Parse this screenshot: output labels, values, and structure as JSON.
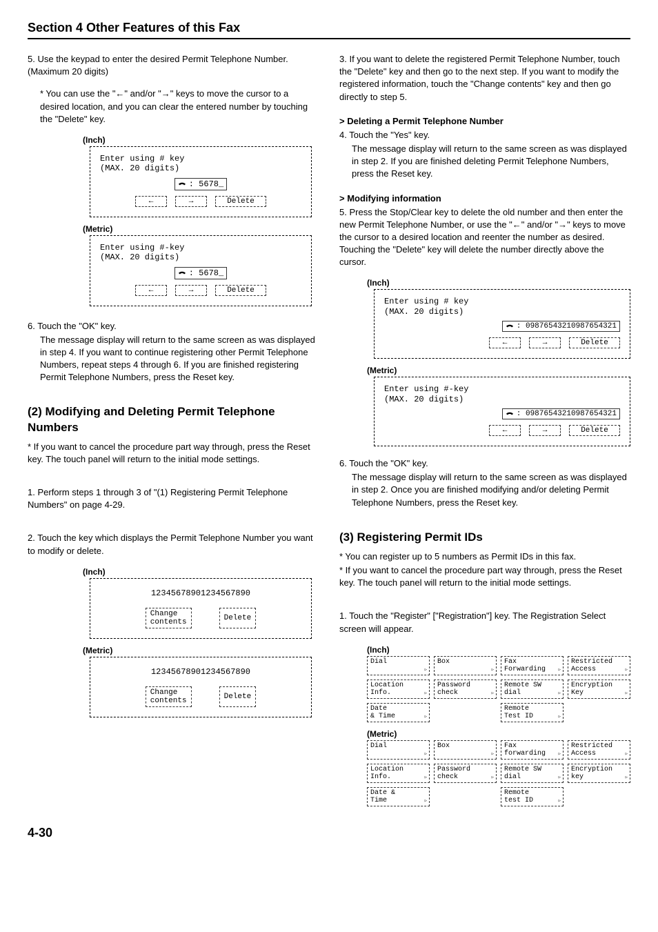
{
  "header": "Section 4 Other Features of this Fax",
  "left": {
    "step5": {
      "num": "5.",
      "text": "Use the keypad to enter the desired Permit Telephone Number. (Maximum 20 digits)",
      "note": "* You can use the \"←\" and/or \"→\" keys to move the cursor to a desired location, and you can clear the entered number by touching the \"Delete\" key."
    },
    "label_inch": "(Inch)",
    "label_metric": "(Metric)",
    "panel_a": {
      "line1": "Enter using # key",
      "line2": "(MAX. 20 digits)",
      "number": ": 5678_",
      "btn_left": "←",
      "btn_right": "→",
      "btn_del": "Delete"
    },
    "panel_b": {
      "line1": "Enter using #-key",
      "line2": "(MAX. 20 digits)",
      "number": ": 5678_",
      "btn_left": "←",
      "btn_right": "→",
      "btn_del": "Delete"
    },
    "step6": {
      "num": "6.",
      "text": "Touch the \"OK\" key.",
      "cont": "The message display will return to the same screen as was displayed in step 4. If you want to continue registering other Permit Telephone Numbers, repeat steps 4 through 6. If you are finished registering Permit Telephone Numbers, press the Reset key."
    },
    "sub2": "(2) Modifying and Deleting Permit Telephone Numbers",
    "sub2_note": "* If you want to cancel the procedure part way through, press the Reset key. The touch panel will return to the initial mode settings.",
    "sub2_step1": {
      "num": "1.",
      "text": "Perform steps 1 through 3 of \"(1) Registering Permit Telephone Numbers\" on page 4-29."
    },
    "sub2_step2": {
      "num": "2.",
      "text": "Touch the key which displays the Permit Telephone Number you want to modify or delete."
    },
    "panel_c": {
      "number": "12345678901234567890",
      "btn_change_l1": "Change",
      "btn_change_l2": "contents",
      "btn_del": "Delete"
    },
    "panel_d": {
      "number": "12345678901234567890",
      "btn_change_l1": "Change",
      "btn_change_l2": "contents",
      "btn_del": "Delete"
    }
  },
  "right": {
    "step3": {
      "num": "3.",
      "text": "If you want to delete the registered Permit Telephone Number, touch the \"Delete\" key and then go to the next step. If you want to modify the registered information, touch the \"Change contents\" key and then go directly to step 5."
    },
    "del_head": "> Deleting a Permit Telephone Number",
    "step4": {
      "num": "4.",
      "text": "Touch the \"Yes\" key.",
      "cont": "The message display will return to the same screen as was displayed in step 2. If you are finished deleting Permit Telephone Numbers, press the Reset key."
    },
    "mod_head": "> Modifying information",
    "step5": {
      "num": "5.",
      "text": "Press the Stop/Clear key to delete the old number and then enter the new Permit Telephone Number, or use the \"←\" and/or \"→\" keys to move the cursor to a desired location and reenter the number as desired. Touching the \"Delete\" key will delete the number directly above the cursor."
    },
    "label_inch": "(Inch)",
    "label_metric": "(Metric)",
    "panel_e": {
      "line1": "Enter using # key",
      "line2": "(MAX. 20 digits)",
      "number": ": 09876543210987654321",
      "btn_left": "←",
      "btn_right": "→",
      "btn_del": "Delete"
    },
    "panel_f": {
      "line1": "Enter using #-key",
      "line2": "(MAX. 20 digits)",
      "number": ": 09876543210987654321",
      "btn_left": "←",
      "btn_right": "→",
      "btn_del": "Delete"
    },
    "step6": {
      "num": "6.",
      "text": "Touch the \"OK\" key.",
      "cont": "The message display will return to the same screen as was displayed in step 2. Once you are finished modifying and/or deleting Permit Telephone Numbers, press the Reset key."
    },
    "sub3": "(3) Registering Permit IDs",
    "sub3_note1": "* You can register up to 5 numbers as Permit IDs in this fax.",
    "sub3_note2": "* If you want to cancel the procedure part way through, press the Reset key. The touch panel will return to the initial mode settings.",
    "sub3_step1": {
      "num": "1.",
      "text": "Touch the \"Register\" [\"Registration\"] key. The Registration Select screen will appear."
    },
    "grid_inch": [
      "Dial",
      "Box",
      "Fax\nForwarding",
      "Restricted\nAccess",
      "Location\nInfo.",
      "Password\ncheck",
      "Remote SW\ndial",
      "Encryption\nKey",
      "Date\n& Time",
      "",
      "Remote\nTest ID",
      ""
    ],
    "grid_metric": [
      "Dial",
      "Box",
      "Fax\nforwarding",
      "Restricted\nAccess",
      "Location\nInfo.",
      "Password\ncheck",
      "Remote SW\ndial",
      "Encryption\nkey",
      "Date &\nTime",
      "",
      "Remote\ntest ID",
      ""
    ]
  },
  "page_num": "4-30"
}
